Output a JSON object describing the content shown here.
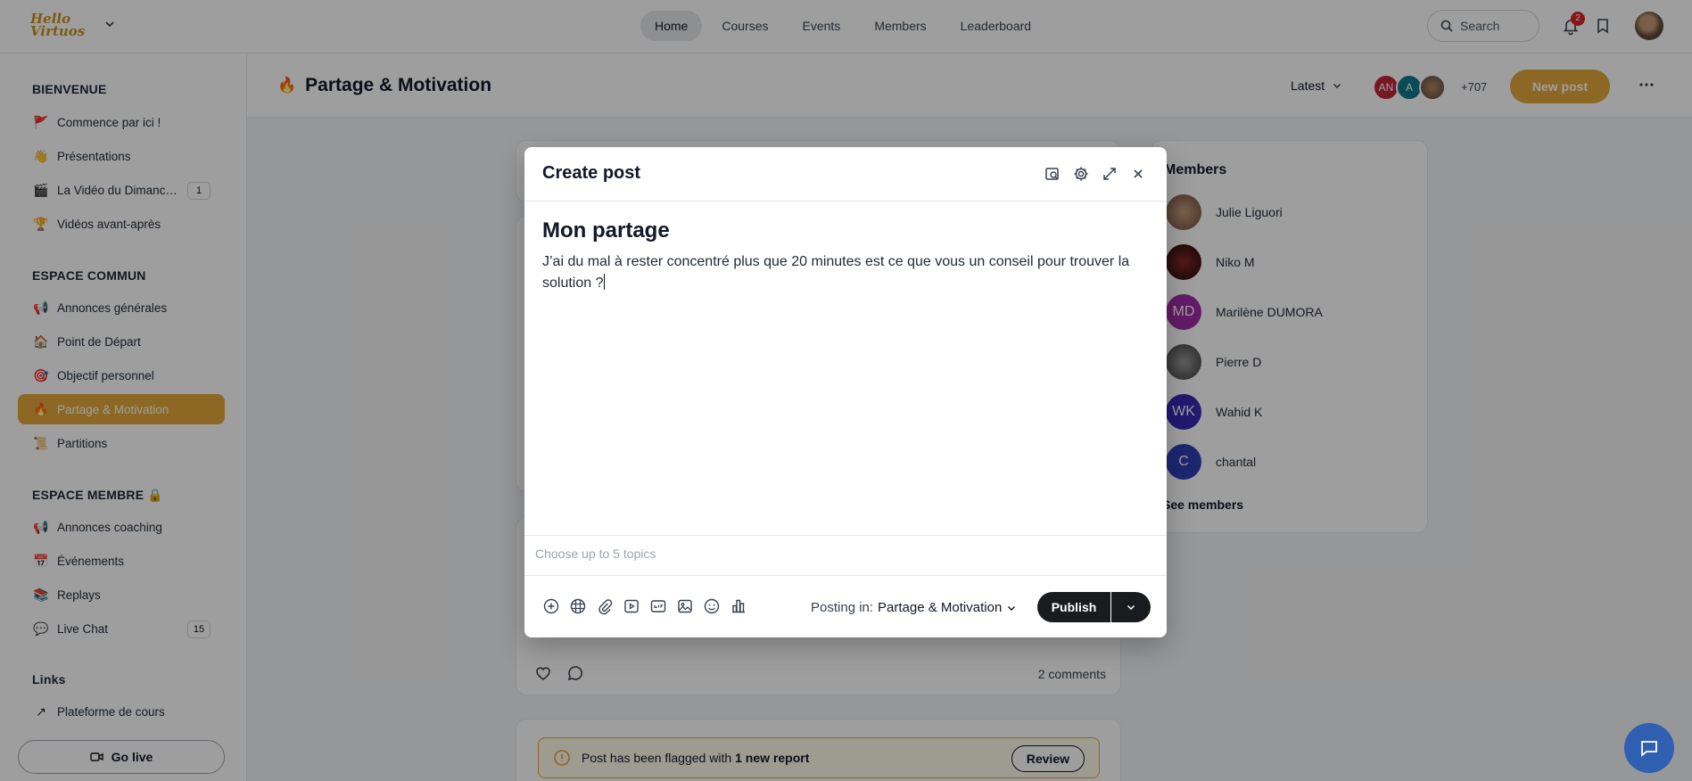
{
  "topbar": {
    "logo_text": "Hello Virtuos",
    "nav": [
      "Home",
      "Courses",
      "Events",
      "Members",
      "Leaderboard"
    ],
    "search_label": "Search",
    "notification_count": "2"
  },
  "sidebar": {
    "sections": [
      {
        "heading": "BIENVENUE",
        "items": [
          {
            "emoji": "🚩",
            "label": "Commence par ici !"
          },
          {
            "emoji": "👋",
            "label": "Présentations"
          },
          {
            "emoji": "🎬",
            "label": "La Vidéo du Dimanc…",
            "count": "1"
          },
          {
            "emoji": "🏆",
            "label": "Vidéos avant-après"
          }
        ]
      },
      {
        "heading": "ESPACE COMMUN",
        "items": [
          {
            "emoji": "📢",
            "label": "Annonces générales"
          },
          {
            "emoji": "🏠",
            "label": "Point de Départ"
          },
          {
            "emoji": "🎯",
            "label": "Objectif personnel"
          },
          {
            "emoji": "🔥",
            "label": "Partage & Motivation",
            "active": true
          },
          {
            "emoji": "📜",
            "label": "Partitions"
          }
        ]
      },
      {
        "heading": "ESPACE MEMBRE 🔒",
        "items": [
          {
            "emoji": "📢",
            "label": "Annonces coaching"
          },
          {
            "emoji": "📅",
            "label": "Événements"
          },
          {
            "emoji": "📚",
            "label": "Replays"
          },
          {
            "emoji": "💬",
            "label": "Live Chat",
            "count": "15"
          }
        ]
      },
      {
        "heading": "Links",
        "items": [
          {
            "emoji": "↗",
            "label": "Plateforme de cours"
          }
        ]
      }
    ],
    "go_live": "Go live"
  },
  "space": {
    "emoji": "🔥",
    "title": "Partage & Motivation",
    "sort": "Latest",
    "avatars": [
      {
        "initials": "AN",
        "color": "#c0263b"
      },
      {
        "initials": "A",
        "color": "#0f7a8c"
      },
      {
        "initials": "",
        "color": "#8a6e5a"
      }
    ],
    "more_count": "+707",
    "new_post": "New post"
  },
  "members": {
    "title": "Members",
    "list": [
      {
        "name": "Julie Liguori",
        "initials": "",
        "color": "#8a6e5a"
      },
      {
        "name": "Niko M",
        "initials": "",
        "color": "#3a2020"
      },
      {
        "name": "Marilène DUMORA",
        "initials": "MD",
        "color": "#a12ca8"
      },
      {
        "name": "Pierre D",
        "initials": "",
        "color": "#5a5a5a"
      },
      {
        "name": "Wahid K",
        "initials": "WK",
        "color": "#3b27b3"
      },
      {
        "name": "chantal",
        "initials": "C",
        "color": "#2f3fb5"
      }
    ],
    "see_all": "See members"
  },
  "feed": {
    "comments": "2 comments",
    "flag_text": "Post has been flagged with",
    "flag_bold": "1 new report",
    "review": "Review"
  },
  "modal": {
    "title": "Create post",
    "post_title": "Mon partage",
    "post_body": "J’ai du mal à rester concentré plus que 20 minutes est ce que vous un conseil pour trouver la solution ?",
    "topics_placeholder": "Choose up to 5 topics",
    "posting_in_label": "Posting in:",
    "posting_in_space": "Partage & Motivation",
    "publish": "Publish"
  },
  "colors": {
    "accent": "#e3a93b",
    "dark_button": "#191b1f",
    "chat": "#2f5fb0"
  }
}
